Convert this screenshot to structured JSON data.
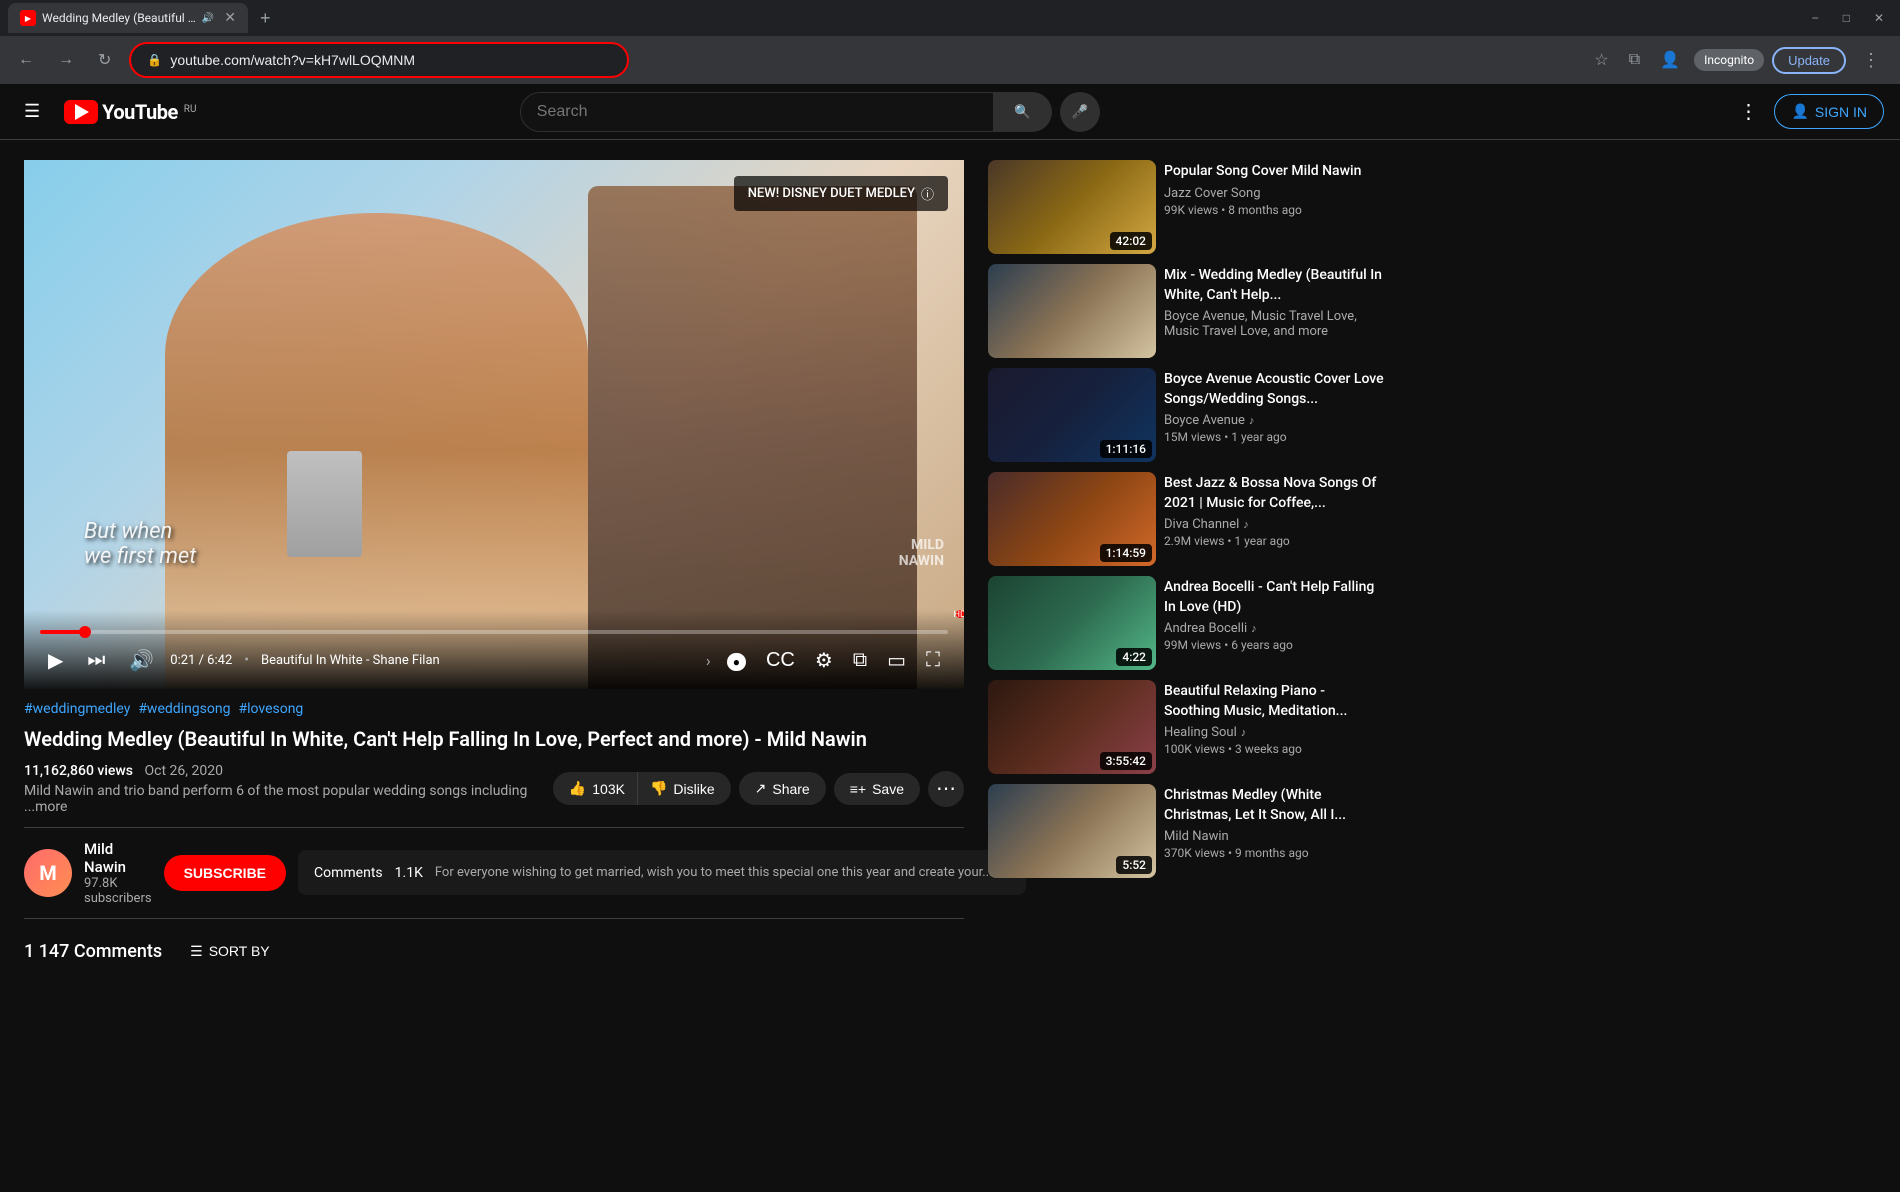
{
  "browser": {
    "tab_title": "Wedding Medley (Beautiful I...",
    "tab_favicon": "▶",
    "tab_audio_icon": "🔊",
    "url": "youtube.com/watch?v=kH7wlLOQMNM",
    "nav_back": "←",
    "nav_forward": "→",
    "nav_reload": "↻",
    "incognito_label": "Incognito",
    "update_label": "Update",
    "new_tab_icon": "+",
    "window_minimize": "−",
    "window_maximize": "□",
    "window_close": "✕",
    "chevron_down": "⌄"
  },
  "youtube": {
    "logo_text": "YouTube",
    "logo_country": "RU",
    "search_placeholder": "Search",
    "search_btn_icon": "🔍",
    "mic_icon": "🎤",
    "more_icon": "⋮",
    "signin_label": "SIGN IN",
    "hamburger_icon": "☰"
  },
  "video": {
    "subtitle_text": "But when\nwe first met",
    "watermark_line1": "MILD",
    "watermark_line2": "NAWIN",
    "overlay_badge": "NEW! DISNEY DUET MEDLEY",
    "overlay_info_icon": "ⓘ",
    "progress_time": "0:21 / 6:42",
    "video_title_ctrl": "Beautiful In White - Shane Filan",
    "play_icon": "▶",
    "next_icon": "⏭",
    "volume_icon": "🔊",
    "settings_icon": "⚙",
    "miniplayer_icon": "⧉",
    "theater_icon": "▭",
    "fullscreen_icon": "⛶",
    "captions_icon": "CC",
    "autoplay_label": "",
    "tags": [
      "#weddingmedley",
      "#weddingsong",
      "#lovesong"
    ],
    "title": "Wedding Medley (Beautiful In White, Can't Help Falling In Love, Perfect and more) - Mild Nawin",
    "views": "11,162,860 views",
    "date": "Oct 26, 2020",
    "description_author": "Mild Nawin and trio band perform 6 of the most popular wedding songs including",
    "description_more": "...more",
    "like_count": "103K",
    "like_icon": "👍",
    "dislike_label": "Dislike",
    "dislike_icon": "👎",
    "share_label": "Share",
    "share_icon": "↗",
    "save_label": "Save",
    "save_icon": "≡+",
    "more_actions_icon": "⋯"
  },
  "channel": {
    "name": "Mild Nawin",
    "subscribers": "97.8K subscribers",
    "avatar_letter": "M",
    "subscribe_label": "SUBSCRIBE"
  },
  "comments": {
    "count": "1.1K",
    "label": "Comments",
    "preview_text": "For everyone wishing to get married, wish you to meet this special one this year and create your...",
    "arrow_icon": "›",
    "sort_label": "SORT BY",
    "sort_icon": "☰",
    "count_big": "1 147 Comments"
  },
  "sidebar": {
    "items": [
      {
        "id": 1,
        "thumb_class": "thumb-bg-1",
        "duration": "42:02",
        "title": "Popular Song Cover Mild Nawin",
        "channel": "Jazz Cover Song",
        "has_music_badge": false,
        "views": "99K views",
        "age": "8 months ago"
      },
      {
        "id": 2,
        "thumb_class": "thumb-bg-2",
        "duration": "",
        "title": "Mix - Wedding Medley (Beautiful In White, Can't Help...",
        "channel": "Boyce Avenue, Music Travel Love, Music Travel Love, and more",
        "has_music_badge": false,
        "views": "",
        "age": ""
      },
      {
        "id": 3,
        "thumb_class": "thumb-bg-3",
        "duration": "1:11:16",
        "title": "Boyce Avenue Acoustic Cover Love Songs/Wedding Songs...",
        "channel": "Boyce Avenue",
        "has_music_badge": true,
        "views": "15M views",
        "age": "1 year ago"
      },
      {
        "id": 4,
        "thumb_class": "thumb-bg-4",
        "duration": "1:14:59",
        "title": "Best Jazz & Bossa Nova Songs Of 2021 | Music for Coffee,...",
        "channel": "Diva Channel",
        "has_music_badge": true,
        "views": "2.9M views",
        "age": "1 year ago"
      },
      {
        "id": 5,
        "thumb_class": "thumb-bg-5",
        "duration": "4:22",
        "title": "Andrea Bocelli - Can't Help Falling In Love (HD)",
        "channel": "Andrea Bocelli",
        "has_music_badge": true,
        "views": "99M views",
        "age": "6 years ago"
      },
      {
        "id": 6,
        "thumb_class": "thumb-bg-6",
        "duration": "3:55:42",
        "title": "Beautiful Relaxing Piano - Soothing Music, Meditation...",
        "channel": "Healing Soul",
        "has_music_badge": true,
        "views": "100K views",
        "age": "3 weeks ago"
      },
      {
        "id": 7,
        "thumb_class": "thumb-bg-2",
        "duration": "5:52",
        "title": "Christmas Medley (White Christmas, Let It Snow, All I...",
        "channel": "Mild Nawin",
        "has_music_badge": false,
        "views": "370K views",
        "age": "9 months ago"
      }
    ]
  }
}
